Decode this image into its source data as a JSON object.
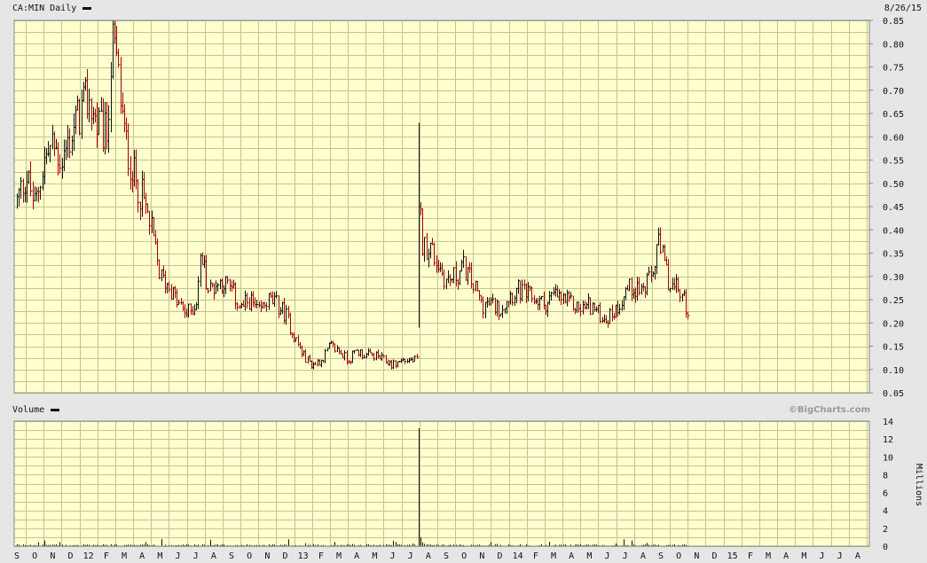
{
  "header": {
    "symbol_label": "CA:MIN Daily",
    "date": "8/26/15"
  },
  "volume_header": {
    "label": "Volume",
    "watermark": "©BigCharts.com"
  },
  "colors": {
    "plot_bg": "#ffffd0",
    "grid": "#c4c48a",
    "up_bar": "#111111",
    "down_bar": "#aa0000",
    "panel_bg": "#e6e6e6"
  },
  "chart_data": [
    {
      "type": "ohlc",
      "title": "CA:MIN Daily",
      "ylim": [
        0.05,
        0.85
      ],
      "yticks": [
        0.85,
        0.8,
        0.75,
        0.7,
        0.65,
        0.6,
        0.55,
        0.5,
        0.45,
        0.4,
        0.35,
        0.3,
        0.25,
        0.2,
        0.15,
        0.1,
        0.05
      ],
      "ytick_labels": [
        "0.85",
        "0.80",
        "0.75",
        "0.70",
        "0.65",
        "0.60",
        "0.55",
        "0.50",
        "0.45",
        "0.40",
        "0.35",
        "0.30",
        "0.25",
        "0.20",
        "0.15",
        "0.10",
        "0.05"
      ],
      "x_month_labels": [
        "S",
        "O",
        "N",
        "D",
        "12",
        "F",
        "M",
        "A",
        "M",
        "J",
        "J",
        "A",
        "S",
        "O",
        "N",
        "D",
        "13",
        "F",
        "M",
        "A",
        "M",
        "J",
        "J",
        "A",
        "S",
        "O",
        "N",
        "D",
        "14",
        "F",
        "M",
        "A",
        "M",
        "J",
        "J",
        "A",
        "S",
        "O",
        "N",
        "D",
        "15",
        "F",
        "M",
        "A",
        "M",
        "J",
        "J",
        "A"
      ],
      "grid": true,
      "anchors_month_close": [
        [
          0,
          0.46
        ],
        [
          0.5,
          0.52
        ],
        [
          1,
          0.45
        ],
        [
          1.5,
          0.55
        ],
        [
          2,
          0.58
        ],
        [
          2.5,
          0.55
        ],
        [
          3,
          0.6
        ],
        [
          3.5,
          0.65
        ],
        [
          4,
          0.68
        ],
        [
          4.5,
          0.62
        ],
        [
          5,
          0.6
        ],
        [
          5.3,
          0.8
        ],
        [
          5.6,
          0.75
        ],
        [
          6,
          0.6
        ],
        [
          6.5,
          0.52
        ],
        [
          7,
          0.47
        ],
        [
          7.5,
          0.4
        ],
        [
          8,
          0.3
        ],
        [
          8.5,
          0.28
        ],
        [
          9,
          0.24
        ],
        [
          9.5,
          0.22
        ],
        [
          10,
          0.24
        ],
        [
          10.3,
          0.35
        ],
        [
          10.7,
          0.27
        ],
        [
          11,
          0.28
        ],
        [
          11.5,
          0.29
        ],
        [
          12,
          0.27
        ],
        [
          12.5,
          0.23
        ],
        [
          13,
          0.25
        ],
        [
          13.5,
          0.22
        ],
        [
          14,
          0.25
        ],
        [
          14.5,
          0.24
        ],
        [
          15,
          0.22
        ],
        [
          15.5,
          0.17
        ],
        [
          16,
          0.13
        ],
        [
          16.5,
          0.11
        ],
        [
          17,
          0.12
        ],
        [
          17.5,
          0.15
        ],
        [
          18,
          0.14
        ],
        [
          18.5,
          0.12
        ],
        [
          19,
          0.14
        ],
        [
          19.5,
          0.13
        ],
        [
          20,
          0.13
        ],
        [
          20.5,
          0.12
        ],
        [
          21,
          0.11
        ],
        [
          21.5,
          0.12
        ],
        [
          22,
          0.12
        ],
        [
          22.45,
          0.12
        ],
        [
          22.5,
          0.45
        ],
        [
          22.7,
          0.36
        ],
        [
          23,
          0.37
        ],
        [
          23.5,
          0.33
        ],
        [
          24,
          0.29
        ],
        [
          24.5,
          0.3
        ],
        [
          25,
          0.32
        ],
        [
          25.5,
          0.28
        ],
        [
          26,
          0.24
        ],
        [
          26.5,
          0.24
        ],
        [
          27,
          0.23
        ],
        [
          27.5,
          0.26
        ],
        [
          28,
          0.27
        ],
        [
          28.5,
          0.26
        ],
        [
          29,
          0.25
        ],
        [
          29.5,
          0.24
        ],
        [
          30,
          0.26
        ],
        [
          30.5,
          0.25
        ],
        [
          31,
          0.24
        ],
        [
          31.5,
          0.23
        ],
        [
          32,
          0.24
        ],
        [
          32.5,
          0.22
        ],
        [
          33,
          0.21
        ],
        [
          33.5,
          0.23
        ],
        [
          34,
          0.27
        ],
        [
          34.5,
          0.28
        ],
        [
          35,
          0.27
        ],
        [
          35.5,
          0.3
        ],
        [
          35.8,
          0.37
        ],
        [
          36,
          0.35
        ],
        [
          36.5,
          0.28
        ],
        [
          37,
          0.27
        ],
        [
          37.5,
          0.23
        ]
      ],
      "notable_points": {
        "start": 0.43,
        "peak_high": 0.85,
        "trough_low": 0.1,
        "spike_high": 0.63,
        "rebound_high": 0.39,
        "last": 0.22
      }
    },
    {
      "type": "bar",
      "title": "Volume",
      "ylabel": "Millions",
      "ylim": [
        0,
        14
      ],
      "yticks": [
        14,
        12,
        10,
        8,
        6,
        4,
        2,
        0
      ],
      "ytick_labels": [
        "14",
        "12",
        "10",
        "8",
        "6",
        "4",
        "2",
        "0"
      ],
      "spike_millions": 13.2,
      "spike_month_index": 22.45,
      "typical_millions": 0.15
    }
  ]
}
